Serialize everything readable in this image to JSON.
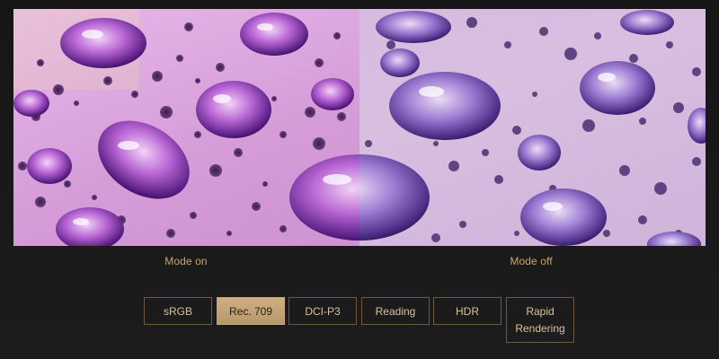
{
  "comparison": {
    "left_label_prefix": "Mode",
    "left_label_state": "on",
    "right_label_prefix": "Mode",
    "right_label_state": "off"
  },
  "modes": [
    {
      "label": "sRGB",
      "active": false
    },
    {
      "label": "Rec. 709",
      "active": true
    },
    {
      "label": "DCI-P3",
      "active": false
    },
    {
      "label": "Reading",
      "active": false
    },
    {
      "label": "HDR",
      "active": false
    },
    {
      "label_line1": "Rapid",
      "label_line2": "Rendering",
      "active": false
    }
  ],
  "colors": {
    "accent": "#c9a46b",
    "active_fill": "#c8a878",
    "border": "#6d5a3e",
    "background": "#181818"
  }
}
